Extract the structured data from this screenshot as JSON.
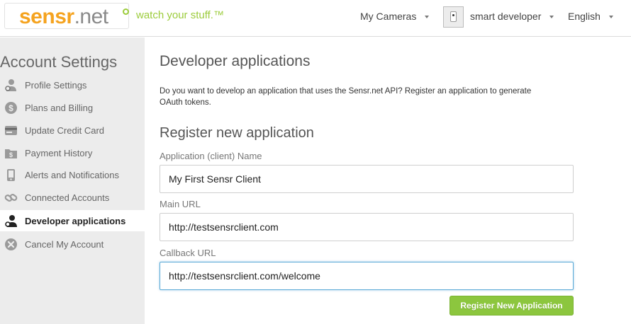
{
  "header": {
    "logo_part1": "sensr",
    "logo_part2": ".net",
    "tagline": "watch your stuff.™",
    "nav_cameras": "My Cameras",
    "user_name": "smart developer",
    "language": "English"
  },
  "sidebar": {
    "title": "Account Settings",
    "items": [
      {
        "label": "Profile Settings",
        "icon": "user-gear-icon"
      },
      {
        "label": "Plans and Billing",
        "icon": "dollar-coin-icon"
      },
      {
        "label": "Update Credit Card",
        "icon": "credit-card-icon"
      },
      {
        "label": "Payment History",
        "icon": "dollar-folder-icon"
      },
      {
        "label": "Alerts and Notifications",
        "icon": "phone-icon"
      },
      {
        "label": "Connected Accounts",
        "icon": "link-icon"
      },
      {
        "label": "Developer applications",
        "icon": "developer-icon",
        "active": true
      },
      {
        "label": "Cancel My Account",
        "icon": "cancel-circle-icon"
      }
    ]
  },
  "main": {
    "title": "Developer applications",
    "intro": "Do you want to develop an application that uses the Sensr.net API? Register an application to generate OAuth tokens.",
    "form_title": "Register new application",
    "fields": {
      "name": {
        "label": "Application (client) Name",
        "value": "My First Sensr Client"
      },
      "main_url": {
        "label": "Main URL",
        "value": "http://testsensrclient.com"
      },
      "callback_url": {
        "label": "Callback URL",
        "value": "http://testsensrclient.com/welcome"
      }
    },
    "submit_label": "Register New Application"
  },
  "colors": {
    "brand_orange": "#f5a31f",
    "brand_green": "#8cc63e",
    "sidebar_bg": "#ececec",
    "focus_blue": "#5aa9d6"
  }
}
